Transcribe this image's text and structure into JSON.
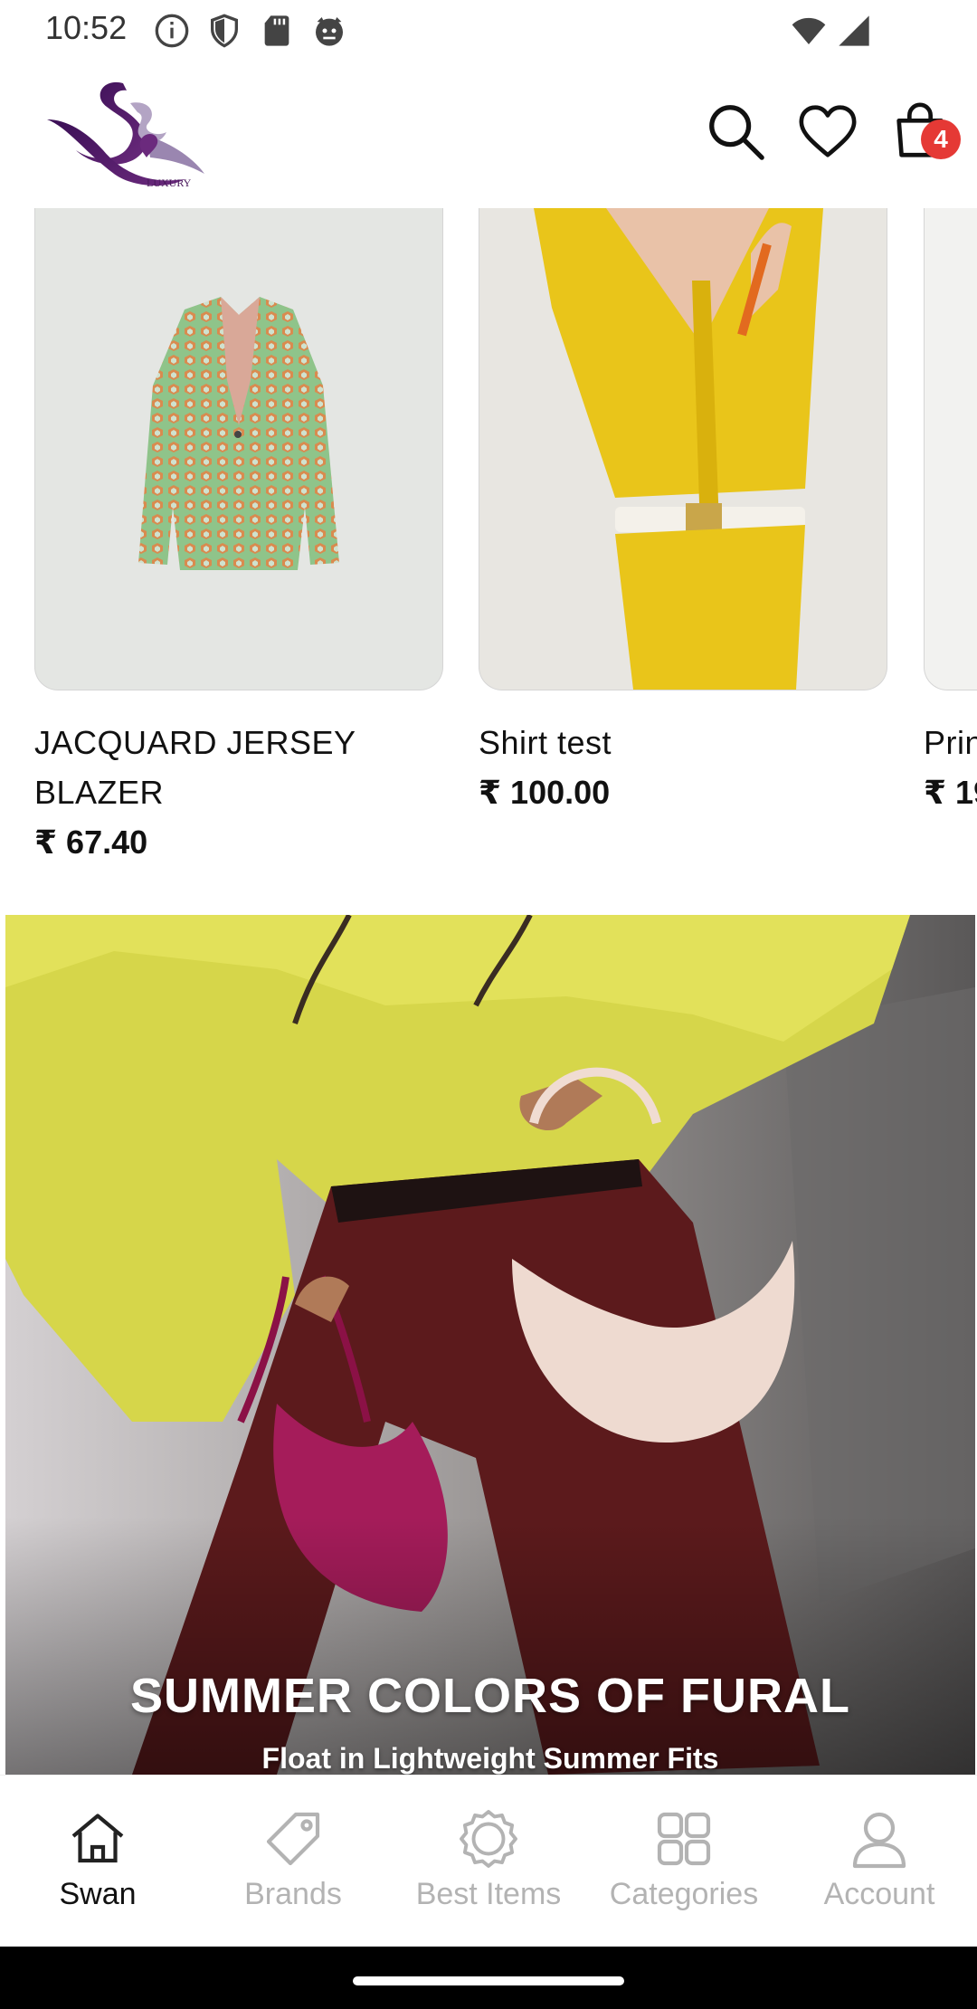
{
  "status_bar": {
    "time": "10:52",
    "icons": [
      "info-icon",
      "shield-icon",
      "sd-card-icon",
      "cat-face-icon"
    ],
    "right_icons": [
      "wifi-icon",
      "signal-icon"
    ]
  },
  "header": {
    "logo_text": "LUXURY",
    "actions": [
      "search-icon",
      "heart-icon",
      "shopping-bag-icon"
    ],
    "cart_count": "4"
  },
  "products": [
    {
      "name": "JACQUARD JERSEY BLAZER",
      "price": "₹ 67.40"
    },
    {
      "name": "Shirt test",
      "price": "₹ 100.00"
    },
    {
      "name": "Prin",
      "price": "₹ 19"
    }
  ],
  "banner": {
    "title": "SUMMER COLORS OF FURAL",
    "subtitle": "Float in Lightweight Summer Fits"
  },
  "bottom_nav": {
    "items": [
      {
        "label": "Swan",
        "icon": "home-icon",
        "active": true
      },
      {
        "label": "Brands",
        "icon": "tag-icon",
        "active": false
      },
      {
        "label": "Best Items",
        "icon": "badge-icon",
        "active": false
      },
      {
        "label": "Categories",
        "icon": "grid-icon",
        "active": false
      },
      {
        "label": "Account",
        "icon": "user-icon",
        "active": false
      }
    ]
  },
  "colors": {
    "accent_active": "#111111",
    "inactive": "#b3b3b3",
    "badge": "#e53935",
    "logo_purple": "#4a1a5c"
  }
}
